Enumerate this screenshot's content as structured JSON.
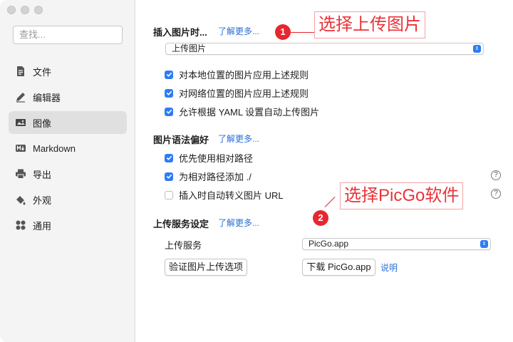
{
  "sidebar": {
    "search_placeholder": "查找...",
    "items": [
      {
        "label": "文件",
        "icon": "document-icon"
      },
      {
        "label": "编辑器",
        "icon": "pencil-icon"
      },
      {
        "label": "图像",
        "icon": "image-icon",
        "active": true
      },
      {
        "label": "Markdown",
        "icon": "markdown-icon"
      },
      {
        "label": "导出",
        "icon": "printer-icon"
      },
      {
        "label": "外观",
        "icon": "paint-bucket-icon"
      },
      {
        "label": "通用",
        "icon": "grid-icon"
      }
    ]
  },
  "insert_section": {
    "title": "插入图片时...",
    "learn_more": "了解更多...",
    "select_value": "上传图片",
    "checkboxes": [
      {
        "label": "对本地位置的图片应用上述规则",
        "checked": true
      },
      {
        "label": "对网络位置的图片应用上述规则",
        "checked": true
      },
      {
        "label": "允许根据 YAML 设置自动上传图片",
        "checked": true
      }
    ]
  },
  "syntax_section": {
    "title": "图片语法偏好",
    "learn_more": "了解更多...",
    "checkboxes": [
      {
        "label": "优先使用相对路径",
        "checked": true
      },
      {
        "label": "为相对路径添加 ./",
        "checked": true
      },
      {
        "label": "插入时自动转义图片 URL",
        "checked": false
      }
    ]
  },
  "upload_section": {
    "title": "上传服务设定",
    "learn_more": "了解更多...",
    "service_label": "上传服务",
    "service_value": "PicGo.app",
    "verify_button": "验证图片上传选项",
    "download_button": "下载 PicGo.app",
    "explain_link": "说明"
  },
  "annotations": {
    "badge1": "1",
    "callout1": "选择上传图片",
    "badge2": "2",
    "callout2": "选择PicGo软件"
  },
  "colors": {
    "accent": "#2d7cf6",
    "link": "#2a6fd6",
    "annotation": "#e8262f"
  }
}
